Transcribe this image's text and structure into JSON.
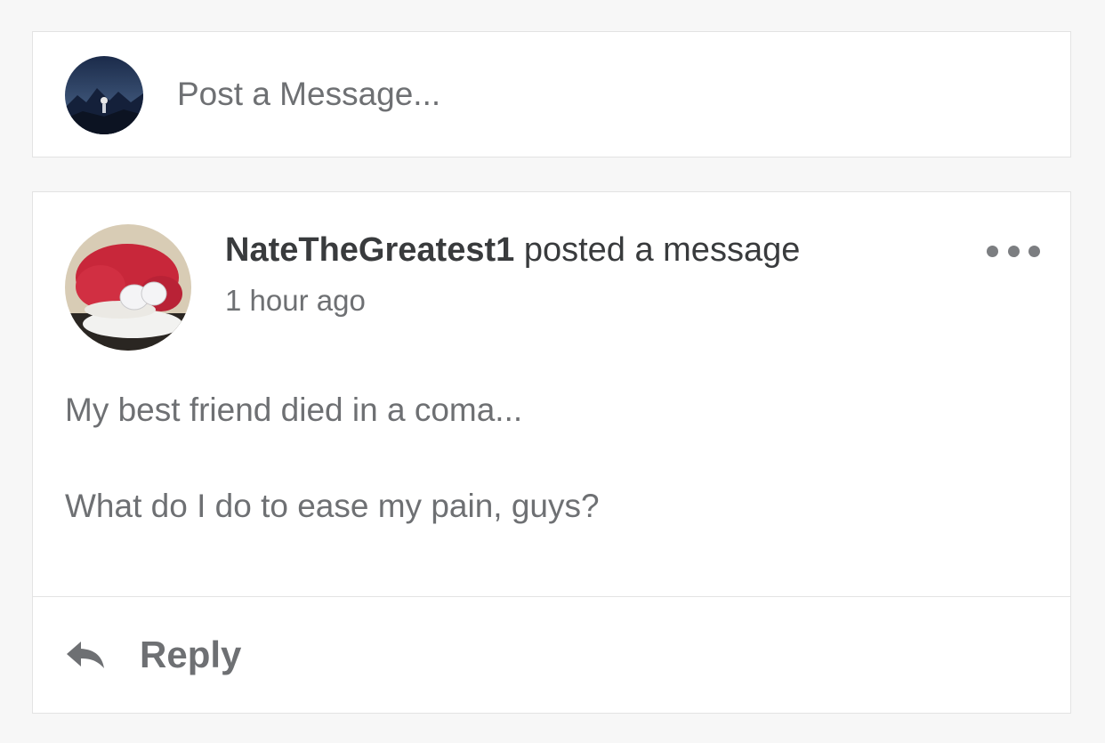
{
  "composer": {
    "placeholder": "Post a Message..."
  },
  "post": {
    "author": "NateTheGreatest1",
    "action_text": "posted a message",
    "timestamp": "1 hour ago",
    "body": [
      "My best friend died in a coma...",
      "What do I do to ease my pain, guys?"
    ],
    "reply_label": "Reply",
    "more_icon": "more-horizontal-icon",
    "reply_icon": "reply-arrow-icon"
  },
  "colors": {
    "background": "#f7f7f7",
    "card": "#ffffff",
    "border": "#e3e3e3",
    "text_primary": "#393b3d",
    "text_secondary": "#6e7073"
  }
}
